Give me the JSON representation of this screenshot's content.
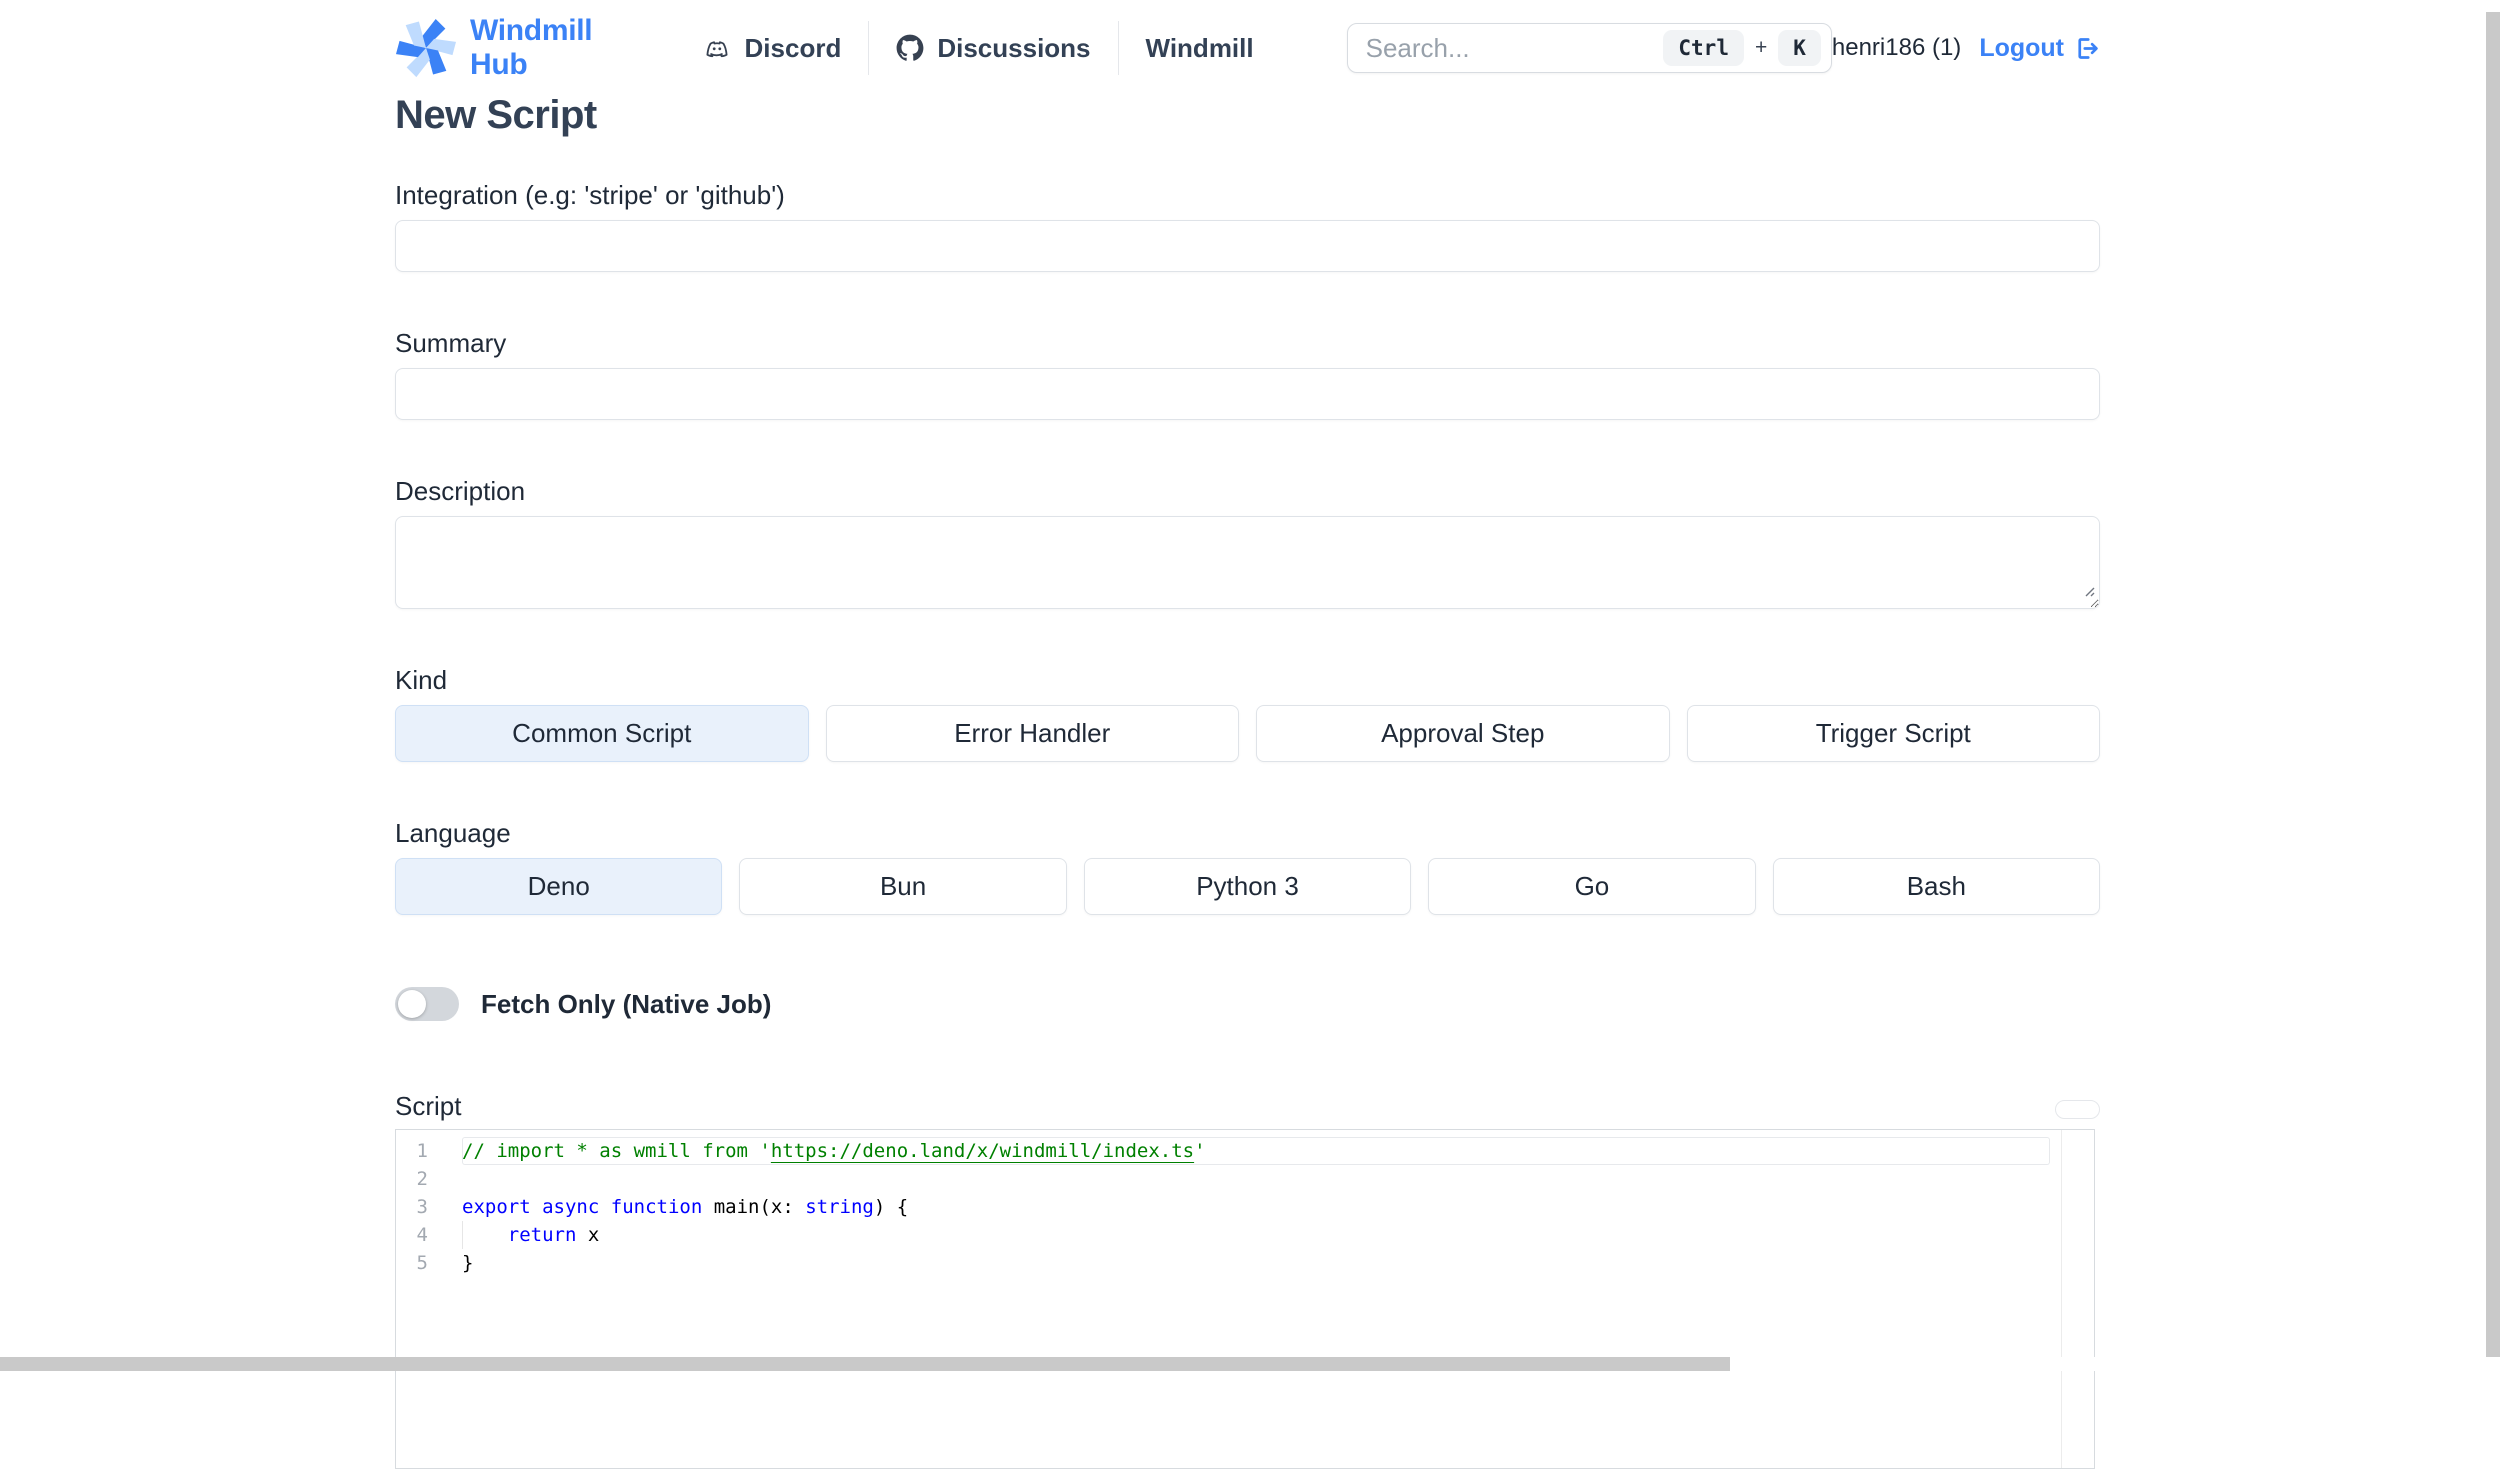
{
  "header": {
    "brand": "Windmill Hub",
    "nav": {
      "discord": "Discord",
      "discussions": "Discussions",
      "windmill": "Windmill"
    },
    "search": {
      "placeholder": "Search...",
      "shortcut_key1": "Ctrl",
      "shortcut_plus": "+",
      "shortcut_key2": "K"
    },
    "username": "henri186 (1)",
    "logout": "Logout"
  },
  "page": {
    "title": "New Script"
  },
  "form": {
    "integration_label": "Integration (e.g: 'stripe' or 'github')",
    "integration_value": "",
    "summary_label": "Summary",
    "summary_value": "",
    "description_label": "Description",
    "description_value": "",
    "kind_label": "Kind",
    "kind_options": [
      "Common Script",
      "Error Handler",
      "Approval Step",
      "Trigger Script"
    ],
    "kind_selected": "Common Script",
    "language_label": "Language",
    "language_options": [
      "Deno",
      "Bun",
      "Python 3",
      "Go",
      "Bash"
    ],
    "language_selected": "Deno",
    "fetch_only_label": "Fetch Only (Native Job)",
    "fetch_only_enabled": false,
    "script_label": "Script"
  },
  "editor": {
    "lines": [
      {
        "number": "1",
        "current": true,
        "segments": [
          {
            "text": "// import * as wmill from '",
            "style": "comment"
          },
          {
            "text": "https://deno.land/x/windmill/index.ts",
            "style": "comment-link"
          },
          {
            "text": "'",
            "style": "comment"
          }
        ]
      },
      {
        "number": "2",
        "segments": []
      },
      {
        "number": "3",
        "segments": [
          {
            "text": "export",
            "style": "keyword"
          },
          {
            "text": " ",
            "style": "plain"
          },
          {
            "text": "async",
            "style": "keyword"
          },
          {
            "text": " ",
            "style": "plain"
          },
          {
            "text": "function",
            "style": "keyword"
          },
          {
            "text": " main(x: ",
            "style": "plain"
          },
          {
            "text": "string",
            "style": "keyword"
          },
          {
            "text": ") {",
            "style": "plain"
          }
        ]
      },
      {
        "number": "4",
        "indent_guide": true,
        "segments": [
          {
            "text": "    ",
            "style": "plain"
          },
          {
            "text": "return",
            "style": "keyword"
          },
          {
            "text": " x",
            "style": "plain"
          }
        ]
      },
      {
        "number": "5",
        "segments": [
          {
            "text": "}",
            "style": "plain"
          }
        ]
      }
    ]
  },
  "colors": {
    "accent": "#3b82f6",
    "brand_light_blue": "#bfdbfe",
    "selected_bg": "#e9f1fb",
    "selected_border": "#cfe0f5",
    "comment_green": "#008000",
    "keyword_blue": "#0000ff",
    "scrollbar": "#c9c9c9"
  }
}
